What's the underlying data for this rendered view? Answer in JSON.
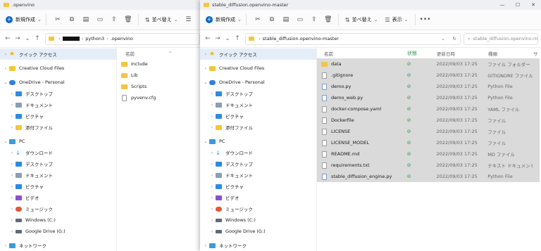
{
  "left_window": {
    "title": ".openvino",
    "toolbar": {
      "new_label": "新規作成",
      "sort_label": "並べ替え"
    },
    "address": {
      "seg1": "python3",
      "seg2": ".openvino"
    },
    "nav": [
      {
        "label": "クイック アクセス",
        "icon": "star-icon"
      },
      {
        "label": "Creative Cloud Files",
        "icon": "creative-cloud-icon"
      },
      {
        "label": "OneDrive - Personal",
        "icon": "cloud-icon"
      },
      {
        "label": "デスクトップ",
        "icon": "desktop-icon"
      },
      {
        "label": "ドキュメント",
        "icon": "documents-icon"
      },
      {
        "label": "ピクチャ",
        "icon": "pictures-icon"
      },
      {
        "label": "添付ファイル",
        "icon": "folder-icon"
      },
      {
        "label": "PC",
        "icon": "pc-icon"
      },
      {
        "label": "ダウンロード",
        "icon": "download-icon"
      },
      {
        "label": "デスクトップ",
        "icon": "desktop-icon"
      },
      {
        "label": "ドキュメント",
        "icon": "documents-icon"
      },
      {
        "label": "ピクチャ",
        "icon": "pictures-icon"
      },
      {
        "label": "ビデオ",
        "icon": "video-icon"
      },
      {
        "label": "ミュージック",
        "icon": "music-icon"
      },
      {
        "label": "Windows (C:)",
        "icon": "drive-icon"
      },
      {
        "label": "Google Drive (G:)",
        "icon": "drive-icon"
      },
      {
        "label": "ネットワーク",
        "icon": "network-icon"
      }
    ],
    "column_name": "名前",
    "files": [
      {
        "name": "Include",
        "kind": "folder"
      },
      {
        "name": "Lib",
        "kind": "folder"
      },
      {
        "name": "Scripts",
        "kind": "folder"
      },
      {
        "name": "pyvenv.cfg",
        "kind": "file"
      }
    ]
  },
  "right_window": {
    "title": "stable_diffusion.openvino-master",
    "toolbar": {
      "new_label": "新規作成",
      "sort_label": "並べ替え",
      "view_label": "表示"
    },
    "address": {
      "seg1": "stable_diffusion.openvino-master"
    },
    "search_placeholder": "stable_diffusion.openvino-m...",
    "columns": {
      "name": "名前",
      "status": "状態",
      "date": "更新日時",
      "type": "種類",
      "size": "サ"
    },
    "files": [
      {
        "name": "data",
        "date": "2022/09/03 17:25",
        "type": "ファイル フォルダー",
        "kind": "folder"
      },
      {
        "name": ".gitignore",
        "date": "2022/09/03 17:25",
        "type": "GITIGNORE ファイル",
        "kind": "file"
      },
      {
        "name": "demo.py",
        "date": "2022/09/03 17:25",
        "type": "Python File",
        "kind": "py"
      },
      {
        "name": "demo_web.py",
        "date": "2022/09/03 17:25",
        "type": "Python File",
        "kind": "py"
      },
      {
        "name": "docker-compose.yaml",
        "date": "2022/09/03 17:25",
        "type": "YAML ファイル",
        "kind": "file"
      },
      {
        "name": "Dockerfile",
        "date": "2022/09/03 17:25",
        "type": "ファイル",
        "kind": "file"
      },
      {
        "name": "LICENSE",
        "date": "2022/09/03 17:25",
        "type": "ファイル",
        "kind": "file"
      },
      {
        "name": "LICENSE_MODEL",
        "date": "2022/09/03 17:25",
        "type": "ファイル",
        "kind": "file"
      },
      {
        "name": "README.md",
        "date": "2022/09/03 17:25",
        "type": "MD ファイル",
        "kind": "file"
      },
      {
        "name": "requirements.txt",
        "date": "2022/09/03 17:25",
        "type": "テキスト ドキュメント",
        "kind": "file"
      },
      {
        "name": "stable_diffusion_engine.py",
        "date": "2022/09/03 17:25",
        "type": "Python File",
        "kind": "py"
      }
    ]
  },
  "colors": {
    "accent": "#0b67c4",
    "selection": "#dadada",
    "nav_active": "#e5eef8",
    "folder": "#f4c542"
  }
}
